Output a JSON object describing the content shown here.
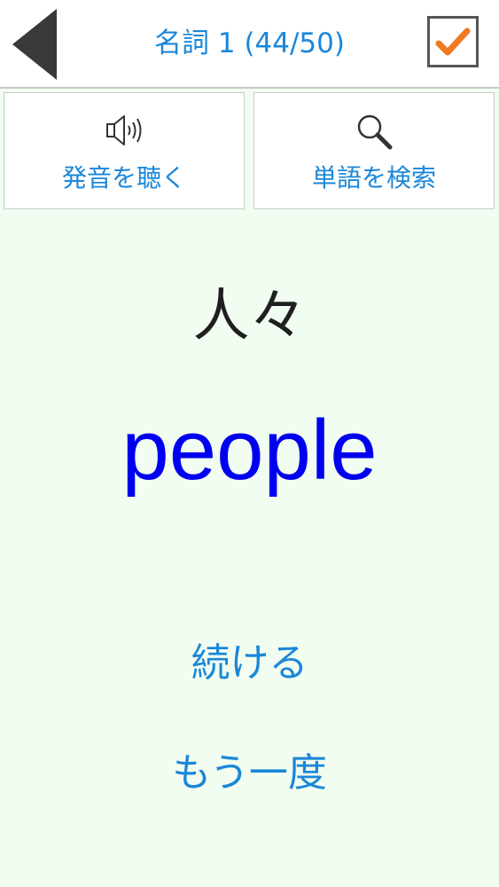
{
  "header": {
    "title": "名詞 1 (44/50)",
    "back_icon": "back-triangle-icon",
    "check_icon": "checkmark-icon"
  },
  "actions": {
    "speak": {
      "label": "発音を聴く",
      "icon": "speaker-icon"
    },
    "search": {
      "label": "単語を検索",
      "icon": "search-icon"
    }
  },
  "card": {
    "japanese": "人々",
    "english": "people"
  },
  "links": {
    "continue": "続ける",
    "again": "もう一度"
  },
  "colors": {
    "accent": "#1a87d9",
    "english_word": "#0000f0",
    "check": "#f07a24",
    "background": "#f2fdf1"
  }
}
